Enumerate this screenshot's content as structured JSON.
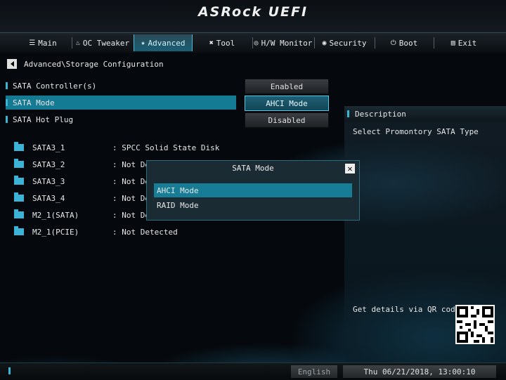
{
  "header": {
    "logo": "ASRock UEFI"
  },
  "tabs": [
    {
      "label": "Main",
      "icon": "list-icon",
      "glyph": "☰"
    },
    {
      "label": "OC Tweaker",
      "icon": "flame-icon",
      "glyph": "♨"
    },
    {
      "label": "Advanced",
      "icon": "star-icon",
      "glyph": "★"
    },
    {
      "label": "Tool",
      "icon": "tools-icon",
      "glyph": "✖"
    },
    {
      "label": "H/W Monitor",
      "icon": "monitor-icon",
      "glyph": "◎"
    },
    {
      "label": "Security",
      "icon": "shield-icon",
      "glyph": "◉"
    },
    {
      "label": "Boot",
      "icon": "power-icon",
      "glyph": "⏻"
    },
    {
      "label": "Exit",
      "icon": "exit-icon",
      "glyph": "▤"
    }
  ],
  "breadcrumb": "Advanced\\Storage Configuration",
  "settings": [
    {
      "label": "SATA Controller(s)",
      "value": "Enabled"
    },
    {
      "label": "SATA Mode",
      "value": "AHCI Mode"
    },
    {
      "label": "SATA Hot Plug",
      "value": "Disabled"
    }
  ],
  "devices": [
    {
      "name": "SATA3_1",
      "value": ": SPCC Solid State Disk"
    },
    {
      "name": "SATA3_2",
      "value": ": Not Detected"
    },
    {
      "name": "SATA3_3",
      "value": ": Not Detected"
    },
    {
      "name": "SATA3_4",
      "value": ": Not Detected"
    },
    {
      "name": "M2_1(SATA)",
      "value": ": Not Detected"
    },
    {
      "name": "M2_1(PCIE)",
      "value": ": Not Detected"
    }
  ],
  "description": {
    "title": "Description",
    "text": "Select Promontory SATA Type",
    "qr_label": "Get details via QR code"
  },
  "modal": {
    "title": "SATA Mode",
    "options": [
      "AHCI Mode",
      "RAID Mode"
    ],
    "selected": "AHCI Mode"
  },
  "footer": {
    "language": "English",
    "datetime": "Thu 06/21/2018, 13:00:10"
  },
  "colors": {
    "accent": "#157a93",
    "highlight": "#3ab6d5"
  }
}
